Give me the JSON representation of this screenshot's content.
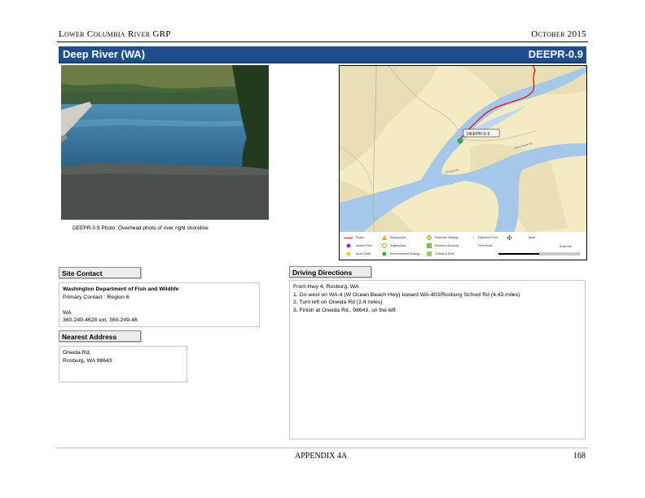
{
  "header": {
    "left": "Lower Columbia River GRP",
    "right": "October 2015"
  },
  "title": {
    "name": "Deep River (WA)",
    "code": "DEEPR-0.9"
  },
  "photo": {
    "caption": "DEEPR-0.9 Photo: Overhead photo of river right shoreline"
  },
  "map": {
    "site_label": "DEEPR-0.9",
    "road_labels": [
      "Oneida Rd",
      "Deep River Rd"
    ],
    "legend": [
      "Roads",
      "Access Point",
      "Staging Area",
      "Boom Fixed",
      "Staging Area",
      "Recommended Strategy",
      "Protection Strategy",
      "Exclusion Booming",
      "Collection Point",
      "Deflection Point",
      "Ferry Route",
      "North",
      "Scale Bar"
    ],
    "colors": {
      "water": "#a6c8e8",
      "land": "#f2ebc4",
      "route": "#e02020",
      "site": "#2bb54a"
    }
  },
  "site_contact": {
    "heading": "Site Contact",
    "org": "Washington Department of Fish and Wildlife",
    "contact": "Primary Contact : Region 6",
    "state": "WA",
    "phone": "360-249-4628 ext. 360-249-46"
  },
  "nearest_address": {
    "heading": "Nearest Address",
    "line1": "Oneida Rd.",
    "line2": "Rosburg, WA 98643"
  },
  "driving_directions": {
    "heading": "Driving Directions",
    "lines": [
      "From Hwy 4, Rosburg, WA",
      "1. Go west on WA-4 (W Ocean Beach Hwy) toward WA-403/Rosburg School Rd (4.43 miles)",
      "2. Turn left on Oneida Rd (2.4 miles)",
      "3. Finish at Oneida Rd., 98643, on the left"
    ]
  },
  "footer": {
    "center": "APPENDIX 4A",
    "page": "168"
  }
}
